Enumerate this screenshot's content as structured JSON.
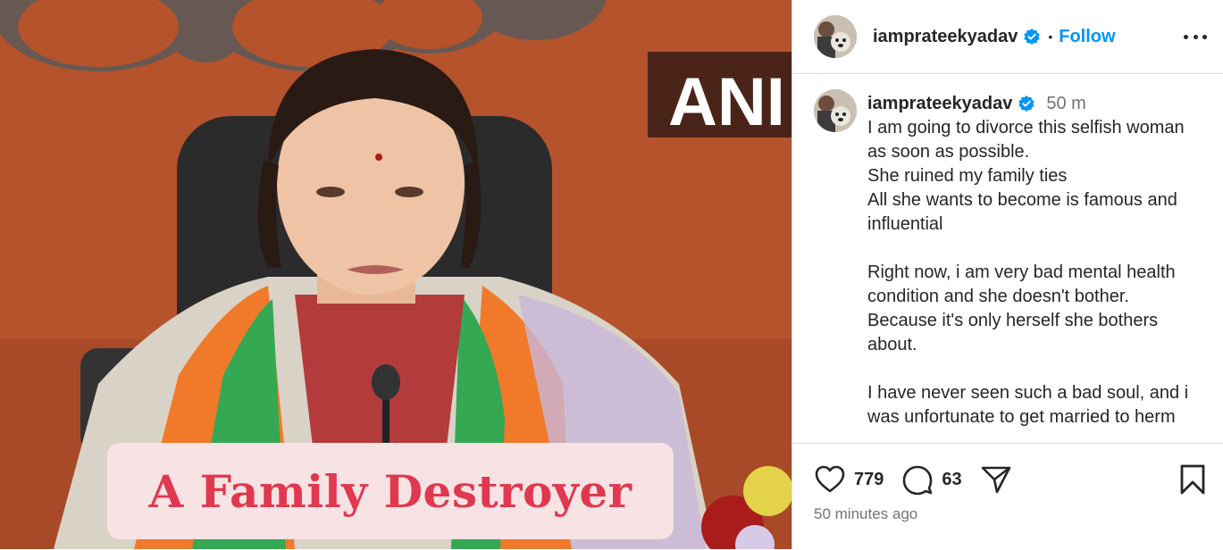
{
  "header": {
    "username": "iamprateekyadav",
    "dot": "•",
    "follow_label": "Follow",
    "more_icon": "more-horizontal-icon"
  },
  "media": {
    "sign_text": "ANI",
    "overlay_caption": "A Family Destroyer",
    "badge_color": "#f7e2e4",
    "caption_color": "#e0384f"
  },
  "comment": {
    "username": "iamprateekyadav",
    "time": "50 m",
    "text": "I am going to divorce this selfish woman as soon as possible.\nShe ruined my family ties\nAll she wants to become is famous and influential\n\nRight now, i am very bad mental health condition and she doesn't bother.\nBecause it's only herself she bothers about.\n\nI have never seen such a bad soul, and i was unfortunate to get married to herm"
  },
  "actions": {
    "likes": "779",
    "comments": "63",
    "posted": "50 minutes ago",
    "icons": [
      "heart-icon",
      "comment-icon",
      "share-icon",
      "bookmark-icon"
    ]
  },
  "colors": {
    "accent": "#0095f6",
    "verified": "#0095f6",
    "muted": "#737373"
  }
}
